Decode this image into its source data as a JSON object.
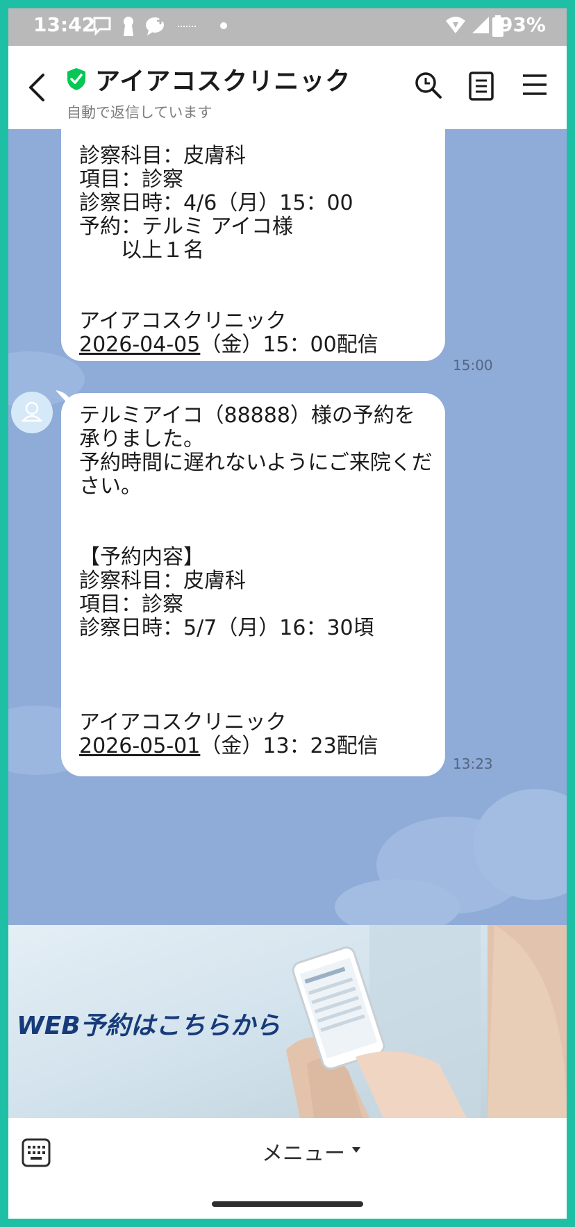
{
  "status_bar": {
    "time": "13:42",
    "battery": "93%"
  },
  "header": {
    "title": "アイアコスクリニック",
    "subtitle": "自動で返信しています"
  },
  "messages": [
    {
      "lines": [
        "診察科目：皮膚科",
        "項目：診察",
        "診察日時：4/6（月）15：00",
        "予約：テルミ アイコ様",
        "　　以上１名"
      ],
      "clinic": "アイアコスクリニック",
      "date_link": "2026-04-05",
      "date_rest": "（金）15：00配信",
      "time": "15:00"
    },
    {
      "lines": [
        "テルミアイコ（88888）様の予約を",
        "承りました。",
        "予約時間に遅れないようにご来院くだ",
        "さい。"
      ],
      "section": "【予約内容】",
      "details": [
        "診察科目：皮膚科",
        "項目：診察",
        "診察日時：5/7（月）16：30頃"
      ],
      "clinic": "アイアコスクリニック",
      "date_link": "2026-05-01",
      "date_rest": "（金）13：23配信",
      "time": "13:23"
    }
  ],
  "banner": {
    "text": "WEB予約はこちらから"
  },
  "bottom": {
    "menu_label": "メニュー"
  },
  "icons": {
    "back": "chevron-left-icon",
    "verified": "shield-check-icon",
    "search": "search-icon",
    "notes": "notes-icon",
    "menu": "hamburger-icon",
    "keyboard": "keyboard-icon",
    "avatar": "person-icon"
  },
  "colors": {
    "frame": "#1fbfa6",
    "chat_background": "#8fabd8",
    "status_bar": "#b9b9b9",
    "verified_green": "#06c755",
    "banner_text": "#173b7a"
  }
}
